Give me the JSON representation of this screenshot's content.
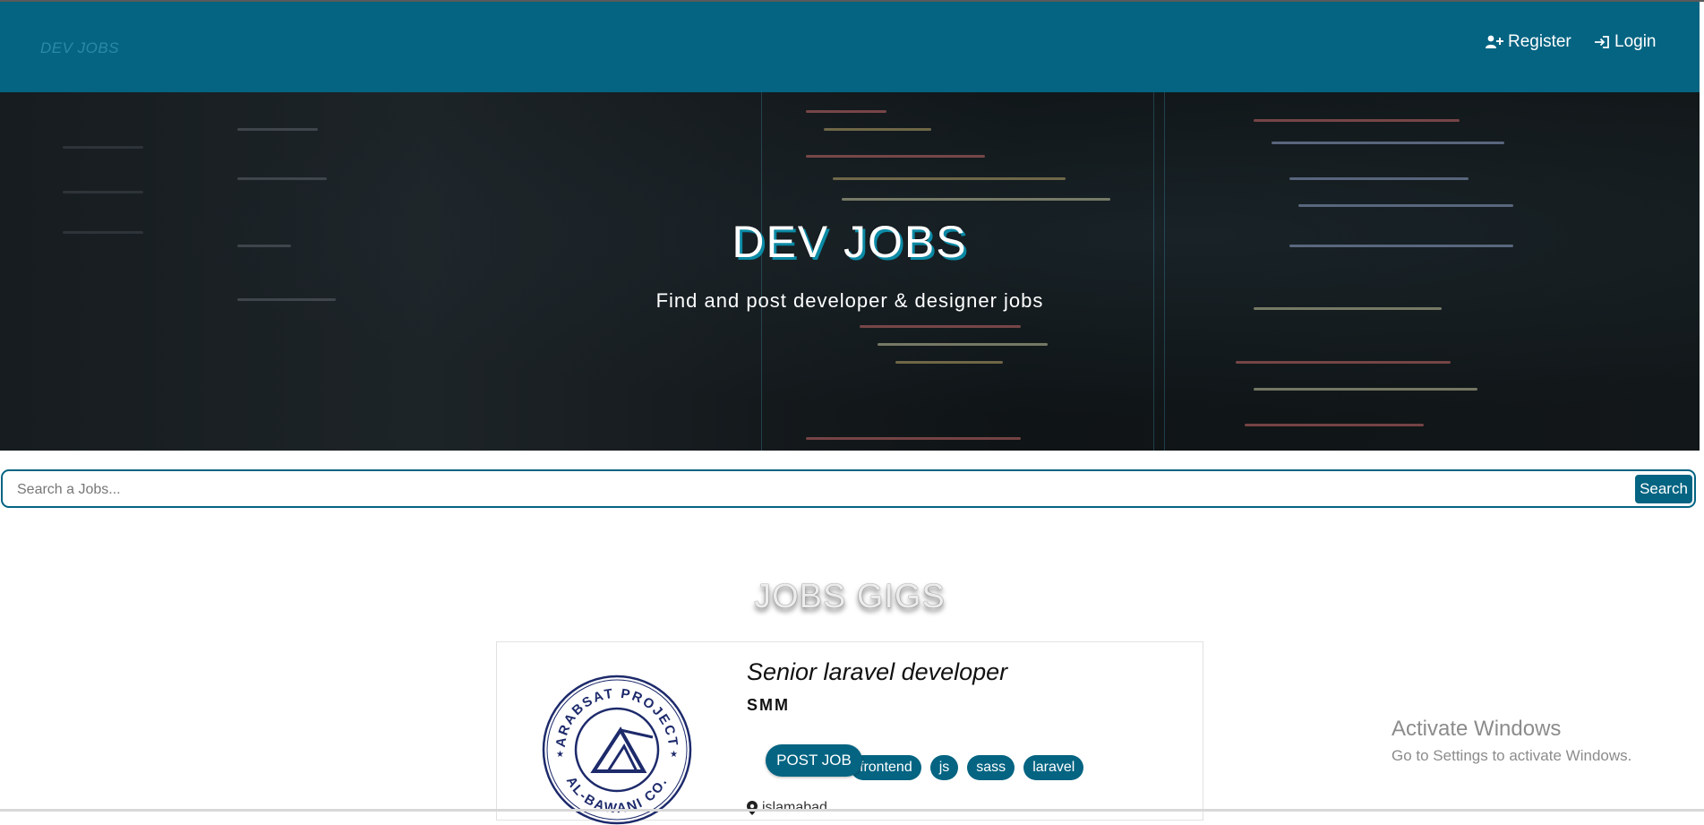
{
  "nav": {
    "brand": "DEV JOBS",
    "register_label": "Register",
    "login_label": "Login",
    "register_icon": "user-plus-icon",
    "login_icon": "sign-in-icon"
  },
  "hero": {
    "title": "DEV JOBS",
    "subtitle": "Find and post developer & designer jobs"
  },
  "search": {
    "placeholder": "Search a Jobs...",
    "value": "",
    "button_label": "Search"
  },
  "section": {
    "title": "JOBS GIGS"
  },
  "job_card": {
    "title": "Senior laravel developer",
    "company": "SMM",
    "tags": [
      "frontend",
      "js",
      "sass",
      "laravel"
    ],
    "location": "islamabad",
    "logo_top_text": "ARABSAT PROJECT",
    "logo_bottom_text": "AL-BAWANI CO."
  },
  "post_job_button": "POST JOB",
  "watermark": {
    "title": "Activate Windows",
    "subtitle": "Go to Settings to activate Windows."
  },
  "colors": {
    "primary": "#046482",
    "accent_shadow": "#0b8aa5"
  }
}
